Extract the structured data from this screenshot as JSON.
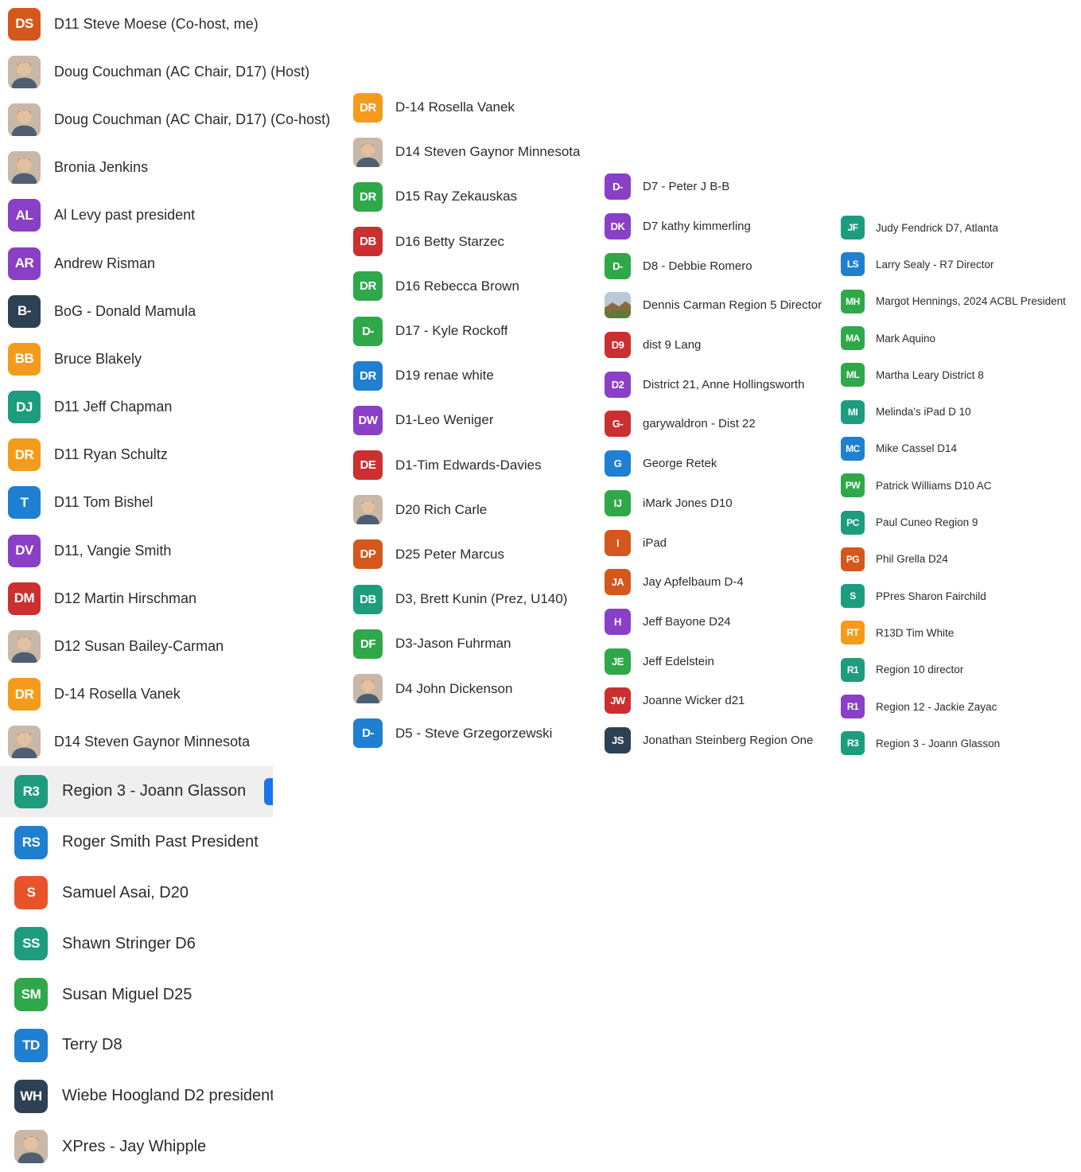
{
  "colors": {
    "orange_dark": "#d4571c",
    "orange": "#f59b1c",
    "purple": "#8a3fc7",
    "navy": "#2d4154",
    "teal": "#1e9c7e",
    "blue": "#1f7fd1",
    "red": "#cc2f2f",
    "green": "#2fa84a",
    "selection": "#efefef",
    "selection_indicator": "#1a73e8"
  },
  "column1": [
    {
      "initials": "DS",
      "name": "D11 Steve Moese (Co-host, me)",
      "color": "#d4571c"
    },
    {
      "initials": "",
      "name": "Doug Couchman (AC Chair, D17) (Host)",
      "photo": "person-photo-icon"
    },
    {
      "initials": "",
      "name": "Doug Couchman (AC Chair, D17) (Co-host)",
      "photo": "person-photo-icon"
    },
    {
      "initials": "",
      "name": "Bronia Jenkins",
      "photo": "person-photo-icon"
    },
    {
      "initials": "AL",
      "name": "Al Levy  past president",
      "color": "#8a3fc7"
    },
    {
      "initials": "AR",
      "name": "Andrew Risman",
      "color": "#8a3fc7"
    },
    {
      "initials": "B-",
      "name": "BoG - Donald Mamula",
      "color": "#2d4154"
    },
    {
      "initials": "BB",
      "name": "Bruce Blakely",
      "color": "#f59b1c"
    },
    {
      "initials": "DJ",
      "name": "D11 Jeff Chapman",
      "color": "#1e9c7e"
    },
    {
      "initials": "DR",
      "name": "D11 Ryan Schultz",
      "color": "#f59b1c"
    },
    {
      "initials": "T",
      "name": "D11 Tom Bishel",
      "color": "#1f7fd1"
    },
    {
      "initials": "DV",
      "name": "D11, Vangie Smith",
      "color": "#8a3fc7"
    },
    {
      "initials": "DM",
      "name": "D12 Martin Hirschman",
      "color": "#cc2f2f"
    },
    {
      "initials": "",
      "name": "D12 Susan Bailey-Carman",
      "photo": "person-photo-icon"
    },
    {
      "initials": "DR",
      "name": "D-14 Rosella Vanek",
      "color": "#f59b1c"
    },
    {
      "initials": "",
      "name": "D14 Steven Gaynor Minnesota",
      "photo": "person-photo-icon"
    }
  ],
  "column1_lower": [
    {
      "initials": "R3",
      "name": "Region 3 - Joann Glasson",
      "color": "#1e9c7e",
      "selected": true
    },
    {
      "initials": "RS",
      "name": "Roger Smith Past President",
      "color": "#1f7fd1"
    },
    {
      "initials": "S",
      "name": "Samuel Asai, D20",
      "color": "#e8532a"
    },
    {
      "initials": "SS",
      "name": "Shawn Stringer D6",
      "color": "#1e9c7e"
    },
    {
      "initials": "SM",
      "name": "Susan Miguel D25",
      "color": "#2fa84a"
    },
    {
      "initials": "TD",
      "name": "Terry D8",
      "color": "#1f7fd1"
    },
    {
      "initials": "WH",
      "name": "Wiebe Hoogland D2 president",
      "color": "#2d4154"
    },
    {
      "initials": "",
      "name": "XPres - Jay Whipple",
      "photo": "person-photo-icon"
    }
  ],
  "column2": [
    {
      "initials": "DR",
      "name": "D-14 Rosella Vanek",
      "color": "#f59b1c"
    },
    {
      "initials": "",
      "name": "D14 Steven Gaynor Minnesota",
      "photo": "person-photo-icon"
    },
    {
      "initials": "DR",
      "name": "D15 Ray Zekauskas",
      "color": "#2fa84a"
    },
    {
      "initials": "DB",
      "name": "D16 Betty Starzec",
      "color": "#cc2f2f"
    },
    {
      "initials": "DR",
      "name": "D16 Rebecca Brown",
      "color": "#2fa84a"
    },
    {
      "initials": "D-",
      "name": "D17 - Kyle Rockoff",
      "color": "#2fa84a"
    },
    {
      "initials": "DR",
      "name": "D19 renae white",
      "color": "#1f7fd1"
    },
    {
      "initials": "DW",
      "name": "D1-Leo Weniger",
      "color": "#8a3fc7"
    },
    {
      "initials": "DE",
      "name": "D1-Tim Edwards-Davies",
      "color": "#cc2f2f"
    },
    {
      "initials": "",
      "name": "D20 Rich Carle",
      "photo": "person-photo-icon"
    },
    {
      "initials": "DP",
      "name": "D25 Peter Marcus",
      "color": "#d4571c"
    },
    {
      "initials": "DB",
      "name": "D3, Brett Kunin (Prez, U140)",
      "color": "#1e9c7e"
    },
    {
      "initials": "DF",
      "name": "D3-Jason Fuhrman",
      "color": "#2fa84a"
    },
    {
      "initials": "",
      "name": "D4 John Dickenson",
      "photo": "person-photo-icon"
    },
    {
      "initials": "D-",
      "name": "D5 - Steve Grzegorzewski",
      "color": "#1f7fd1"
    }
  ],
  "column3": [
    {
      "initials": "D-",
      "name": "D7 - Peter J B-B",
      "color": "#8a3fc7"
    },
    {
      "initials": "DK",
      "name": "D7 kathy kimmerling",
      "color": "#8a3fc7"
    },
    {
      "initials": "D-",
      "name": "D8 - Debbie Romero",
      "color": "#2fa84a"
    },
    {
      "initials": "",
      "name": "Dennis Carman Region 5 Director",
      "photo": "landscape-photo-icon"
    },
    {
      "initials": "D9",
      "name": "dist 9  Lang",
      "color": "#cc2f2f"
    },
    {
      "initials": "D2",
      "name": "District 21, Anne Hollingsworth",
      "color": "#8a3fc7"
    },
    {
      "initials": "G-",
      "name": "garywaldron - Dist 22",
      "color": "#cc2f2f"
    },
    {
      "initials": "G",
      "name": "George Retek",
      "color": "#1f7fd1"
    },
    {
      "initials": "IJ",
      "name": "iMark Jones D10",
      "color": "#2fa84a"
    },
    {
      "initials": "I",
      "name": "iPad",
      "color": "#d4571c"
    },
    {
      "initials": "JA",
      "name": "Jay Apfelbaum D-4",
      "color": "#d4571c"
    },
    {
      "initials": "H",
      "name": "Jeff Bayone D24",
      "color": "#8a3fc7"
    },
    {
      "initials": "JE",
      "name": "Jeff Edelstein",
      "color": "#2fa84a"
    },
    {
      "initials": "JW",
      "name": "Joanne Wicker d21",
      "color": "#cc2f2f"
    },
    {
      "initials": "JS",
      "name": "Jonathan Steinberg Region One",
      "color": "#2d4154"
    }
  ],
  "column4": [
    {
      "initials": "JF",
      "name": "Judy Fendrick D7, Atlanta",
      "color": "#1e9c7e"
    },
    {
      "initials": "LS",
      "name": "Larry Sealy - R7 Director",
      "color": "#1f7fd1"
    },
    {
      "initials": "MH",
      "name": "Margot Hennings, 2024 ACBL President",
      "color": "#2fa84a"
    },
    {
      "initials": "MA",
      "name": "Mark Aquino",
      "color": "#2fa84a"
    },
    {
      "initials": "ML",
      "name": "Martha Leary District 8",
      "color": "#2fa84a"
    },
    {
      "initials": "MI",
      "name": "Melinda's iPad D 10",
      "color": "#1e9c7e"
    },
    {
      "initials": "MC",
      "name": "Mike Cassel D14",
      "color": "#1f7fd1"
    },
    {
      "initials": "PW",
      "name": "Patrick Williams D10 AC",
      "color": "#2fa84a"
    },
    {
      "initials": "PC",
      "name": "Paul Cuneo Region 9",
      "color": "#1e9c7e"
    },
    {
      "initials": "PG",
      "name": "Phil Grella  D24",
      "color": "#d4571c"
    },
    {
      "initials": "S",
      "name": "PPres Sharon Fairchild",
      "color": "#1e9c7e"
    },
    {
      "initials": "RT",
      "name": "R13D Tim White",
      "color": "#f59b1c"
    },
    {
      "initials": "R1",
      "name": "Region 10 director",
      "color": "#1e9c7e"
    },
    {
      "initials": "R1",
      "name": "Region 12 - Jackie Zayac",
      "color": "#8a3fc7"
    },
    {
      "initials": "R3",
      "name": "Region 3 - Joann Glasson",
      "color": "#1e9c7e"
    }
  ]
}
